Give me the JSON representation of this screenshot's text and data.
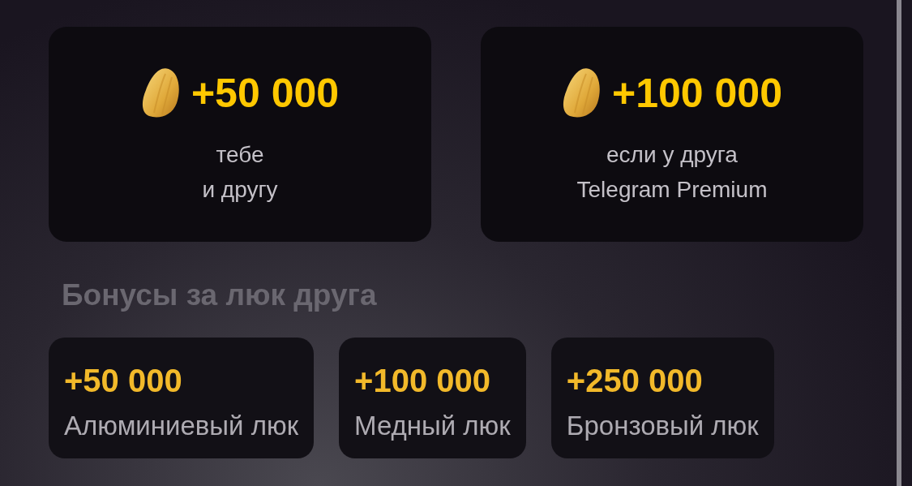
{
  "reward_cards": [
    {
      "amount": "+50 000",
      "lines": [
        "тебе",
        "и другу"
      ]
    },
    {
      "amount": "+100 000",
      "lines": [
        "если у друга",
        "Telegram Premium"
      ]
    }
  ],
  "bonuses_title": "Бонусы за люк друга",
  "bonuses": [
    {
      "amount": "+50 000",
      "label": "Алюминиевый люк"
    },
    {
      "amount": "+100 000",
      "label": "Медный люк"
    },
    {
      "amount": "+250 000",
      "label": "Бронзовый люк"
    }
  ]
}
